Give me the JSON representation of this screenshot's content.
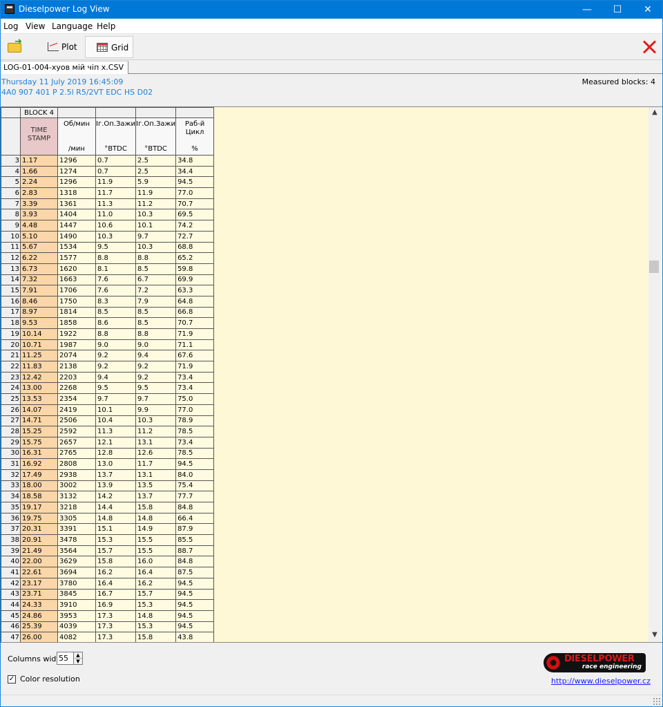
{
  "window": {
    "title": "Dieselpower Log View",
    "minimize": "—",
    "maximize": "☐",
    "close": "✕"
  },
  "menu": [
    "Log",
    "View",
    "Language",
    "Help"
  ],
  "toolbar": {
    "plot_label": "Plot",
    "grid_label": "Grid"
  },
  "file_tab": "LOG-01-004-хуов мій чіп  x.CSV",
  "info": {
    "date": "Thursday 11 July 2019 16:45:09",
    "ecu": "4A0 907 401 P  2.5l R5/2VT EDC  HS D02",
    "measured_blocks": "Measured blocks: 4"
  },
  "grid": {
    "block_label": "BLOCK 4",
    "columns": [
      {
        "header": "TIME\nSTAMP",
        "unit": ""
      },
      {
        "header": "Об/мин",
        "unit": "/мин"
      },
      {
        "header": "Іг.Оп.Зажи",
        "unit": "°BTDC"
      },
      {
        "header": "Іг.Оп.Зажи",
        "unit": "°BTDC"
      },
      {
        "header": "Раб-й\nЦикл",
        "unit": "%"
      }
    ],
    "rows": [
      [
        "3",
        "1.17",
        "1296",
        "0.7",
        "2.5",
        "34.8"
      ],
      [
        "4",
        "1.66",
        "1274",
        "0.7",
        "2.5",
        "34.4"
      ],
      [
        "5",
        "2.24",
        "1296",
        "11.9",
        "5.9",
        "94.5"
      ],
      [
        "6",
        "2.83",
        "1318",
        "11.7",
        "11.9",
        "77.0"
      ],
      [
        "7",
        "3.39",
        "1361",
        "11.3",
        "11.2",
        "70.7"
      ],
      [
        "8",
        "3.93",
        "1404",
        "11.0",
        "10.3",
        "69.5"
      ],
      [
        "9",
        "4.48",
        "1447",
        "10.6",
        "10.1",
        "74.2"
      ],
      [
        "10",
        "5.10",
        "1490",
        "10.3",
        "9.7",
        "72.7"
      ],
      [
        "11",
        "5.67",
        "1534",
        "9.5",
        "10.3",
        "68.8"
      ],
      [
        "12",
        "6.22",
        "1577",
        "8.8",
        "8.8",
        "65.2"
      ],
      [
        "13",
        "6.73",
        "1620",
        "8.1",
        "8.5",
        "59.8"
      ],
      [
        "14",
        "7.32",
        "1663",
        "7.6",
        "6.7",
        "69.9"
      ],
      [
        "15",
        "7.91",
        "1706",
        "7.6",
        "7.2",
        "63.3"
      ],
      [
        "16",
        "8.46",
        "1750",
        "8.3",
        "7.9",
        "64.8"
      ],
      [
        "17",
        "8.97",
        "1814",
        "8.5",
        "8.5",
        "66.8"
      ],
      [
        "18",
        "9.53",
        "1858",
        "8.6",
        "8.5",
        "70.7"
      ],
      [
        "19",
        "10.14",
        "1922",
        "8.8",
        "8.8",
        "71.9"
      ],
      [
        "20",
        "10.71",
        "1987",
        "9.0",
        "9.0",
        "71.1"
      ],
      [
        "21",
        "11.25",
        "2074",
        "9.2",
        "9.4",
        "67.6"
      ],
      [
        "22",
        "11.83",
        "2138",
        "9.2",
        "9.2",
        "71.9"
      ],
      [
        "23",
        "12.42",
        "2203",
        "9.4",
        "9.2",
        "73.4"
      ],
      [
        "24",
        "13.00",
        "2268",
        "9.5",
        "9.5",
        "73.4"
      ],
      [
        "25",
        "13.53",
        "2354",
        "9.7",
        "9.7",
        "75.0"
      ],
      [
        "26",
        "14.07",
        "2419",
        "10.1",
        "9.9",
        "77.0"
      ],
      [
        "27",
        "14.71",
        "2506",
        "10.4",
        "10.3",
        "78.9"
      ],
      [
        "28",
        "15.25",
        "2592",
        "11.3",
        "11.2",
        "78.5"
      ],
      [
        "29",
        "15.75",
        "2657",
        "12.1",
        "13.1",
        "73.4"
      ],
      [
        "30",
        "16.31",
        "2765",
        "12.8",
        "12.6",
        "78.5"
      ],
      [
        "31",
        "16.92",
        "2808",
        "13.0",
        "11.7",
        "94.5"
      ],
      [
        "32",
        "17.49",
        "2938",
        "13.7",
        "13.1",
        "84.0"
      ],
      [
        "33",
        "18.00",
        "3002",
        "13.9",
        "13.5",
        "75.4"
      ],
      [
        "34",
        "18.58",
        "3132",
        "14.2",
        "13.7",
        "77.7"
      ],
      [
        "35",
        "19.17",
        "3218",
        "14.4",
        "15.8",
        "84.8"
      ],
      [
        "36",
        "19.75",
        "3305",
        "14.8",
        "14.8",
        "66.4"
      ],
      [
        "37",
        "20.31",
        "3391",
        "15.1",
        "14.9",
        "87.9"
      ],
      [
        "38",
        "20.91",
        "3478",
        "15.3",
        "15.5",
        "85.5"
      ],
      [
        "39",
        "21.49",
        "3564",
        "15.7",
        "15.5",
        "88.7"
      ],
      [
        "40",
        "22.00",
        "3629",
        "15.8",
        "16.0",
        "84.8"
      ],
      [
        "41",
        "22.61",
        "3694",
        "16.2",
        "16.4",
        "87.5"
      ],
      [
        "42",
        "23.17",
        "3780",
        "16.4",
        "16.2",
        "94.5"
      ],
      [
        "43",
        "23.71",
        "3845",
        "16.7",
        "15.7",
        "94.5"
      ],
      [
        "44",
        "24.33",
        "3910",
        "16.9",
        "15.3",
        "94.5"
      ],
      [
        "45",
        "24.86",
        "3953",
        "17.3",
        "14.8",
        "94.5"
      ],
      [
        "46",
        "25.39",
        "4039",
        "17.3",
        "15.3",
        "94.5"
      ],
      [
        "47",
        "26.00",
        "4082",
        "17.3",
        "15.8",
        "43.8"
      ]
    ]
  },
  "bottom": {
    "columns_width_label": "Columns width:",
    "columns_width_value": "55",
    "color_resolution_label": "Color resolution",
    "color_resolution_checked": "✓",
    "logo_brand": "DIESELPOWER",
    "logo_sub": "race engineering",
    "url": "http://www.dieselpower.cz"
  },
  "colors": {
    "title_bar": "#0078d7",
    "info_text": "#1e7fd6",
    "grid_bg": "#fff8d6",
    "timestamp_col": "#fad6a8",
    "close_x": "#e02020"
  }
}
